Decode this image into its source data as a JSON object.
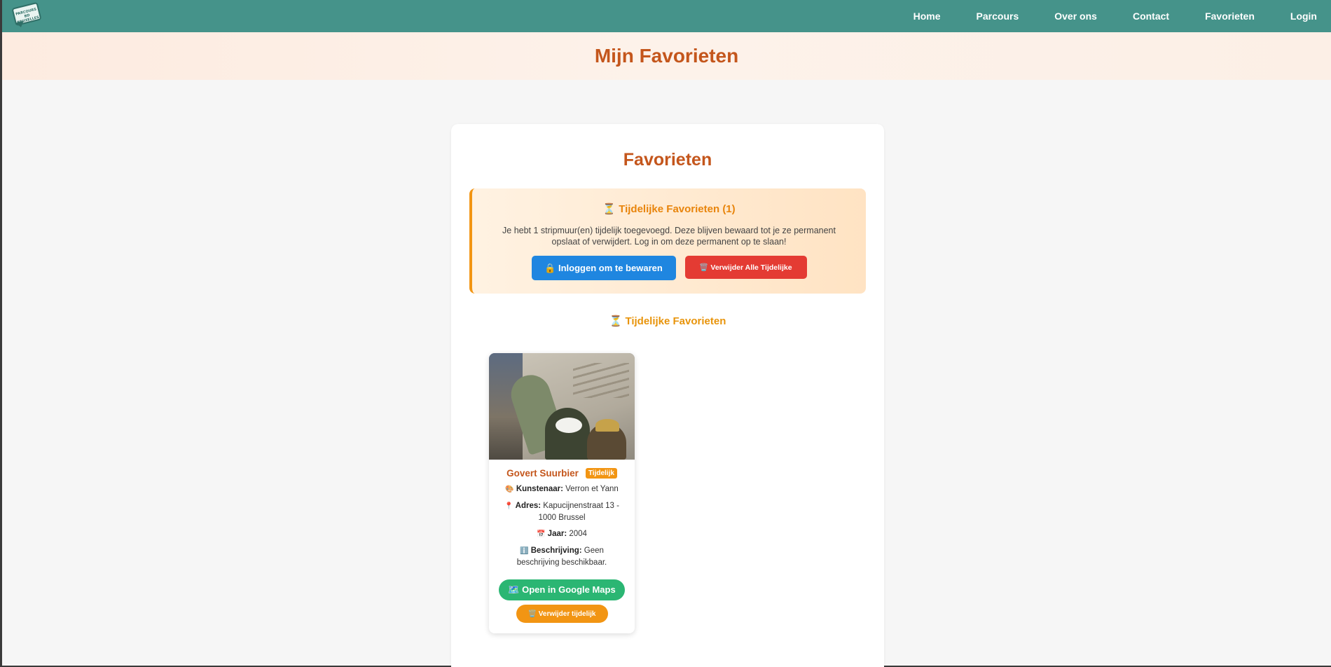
{
  "nav": {
    "logo_text": "PARCOURS BD BRUXELLES",
    "links": [
      "Home",
      "Parcours",
      "Over ons",
      "Contact",
      "Favorieten",
      "Login"
    ]
  },
  "hero": {
    "title": "Mijn Favorieten"
  },
  "main": {
    "title": "Favorieten",
    "notice": {
      "icon": "⏳",
      "title": "Tijdelijke Favorieten (1)",
      "text": "Je hebt 1 stripmuur(en) tijdelijk toegevoegd. Deze blijven bewaard tot je ze permanent opslaat of verwijdert. Log in om deze permanent op te slaan!",
      "login_button": "🔒 Inloggen om te bewaren",
      "delete_all_button": "🗑️ Verwijder Alle Tijdelijke"
    },
    "section_title": "⏳ Tijdelijke Favorieten",
    "favorites": [
      {
        "name": "Govert Suurbier",
        "badge": "Tijdelijk",
        "artist_label": "Kunstenaar:",
        "artist": "Verron et Yann",
        "address_label": "Adres:",
        "address": "Kapucijnenstraat 13 - 1000 Brussel",
        "year_label": "Jaar:",
        "year": "2004",
        "description_label": "Beschrijving:",
        "description": "Geen beschrijving beschikbaar.",
        "maps_button": "🗺️ Open in Google Maps",
        "remove_button": "🗑️ Verwijder tijdelijk"
      }
    ]
  },
  "colors": {
    "navbar": "#45938a",
    "accent": "#c4561c",
    "warning": "#f29513",
    "login": "#1f86e0",
    "danger": "#e43b33",
    "maps": "#2bb673"
  }
}
